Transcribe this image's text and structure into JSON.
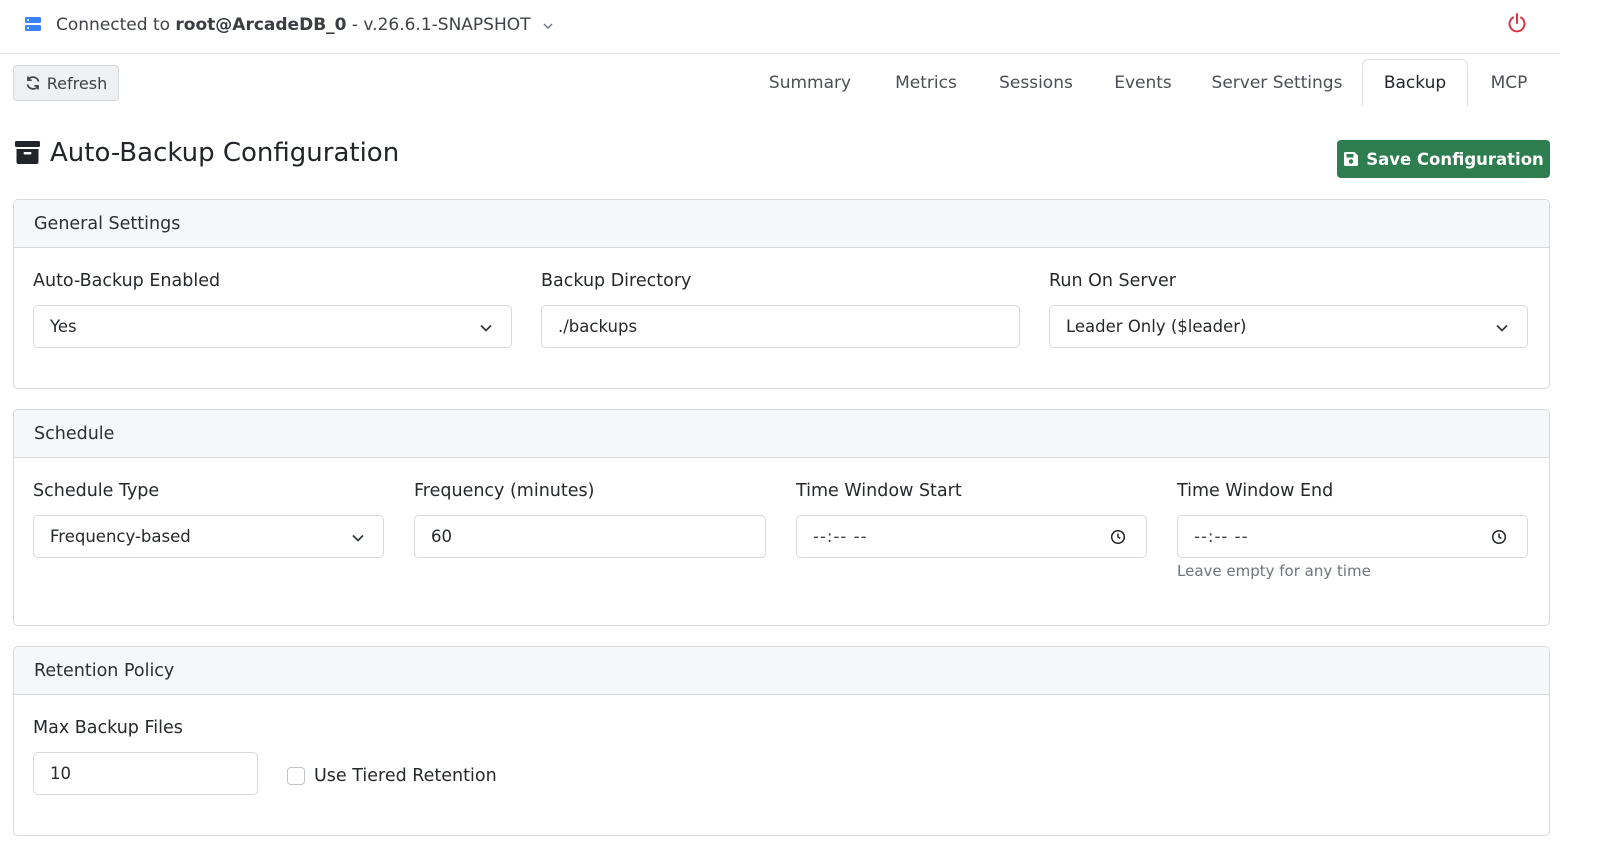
{
  "header": {
    "connected_prefix": "Connected to",
    "user_host": "root@ArcadeDB_0",
    "version": "- v.26.6.1-SNAPSHOT"
  },
  "toolbar": {
    "refresh_label": "Refresh"
  },
  "tabs": [
    {
      "label": "Summary",
      "active": false
    },
    {
      "label": "Metrics",
      "active": false
    },
    {
      "label": "Sessions",
      "active": false
    },
    {
      "label": "Events",
      "active": false
    },
    {
      "label": "Server Settings",
      "active": false
    },
    {
      "label": "Backup",
      "active": true
    },
    {
      "label": "MCP",
      "active": false
    }
  ],
  "page": {
    "title": "Auto-Backup Configuration",
    "save_label": "Save Configuration"
  },
  "general": {
    "title": "General Settings",
    "enabled_label": "Auto-Backup Enabled",
    "enabled_value": "Yes",
    "directory_label": "Backup Directory",
    "directory_value": "./backups",
    "run_on_label": "Run On Server",
    "run_on_value": "Leader Only ($leader)"
  },
  "schedule": {
    "title": "Schedule",
    "type_label": "Schedule Type",
    "type_value": "Frequency-based",
    "frequency_label": "Frequency (minutes)",
    "frequency_value": "60",
    "start_label": "Time Window Start",
    "start_value": "--:-- --",
    "end_label": "Time Window End",
    "end_value": "--:-- --",
    "end_help": "Leave empty for any time"
  },
  "retention": {
    "title": "Retention Policy",
    "max_label": "Max Backup Files",
    "max_value": "10",
    "tiered_label": "Use Tiered Retention",
    "tiered_checked": false
  },
  "colors": {
    "primary_green": "#2e7d4f",
    "power_red": "#dc3545",
    "server_icon_blue": "#3b82f6"
  },
  "icons": {
    "server": "server-icon",
    "power": "power-icon",
    "refresh": "refresh-icon",
    "archive": "archive-icon",
    "save": "floppy-disk-icon",
    "dropdown": "chevron-down-icon",
    "time": "clock-icon"
  }
}
